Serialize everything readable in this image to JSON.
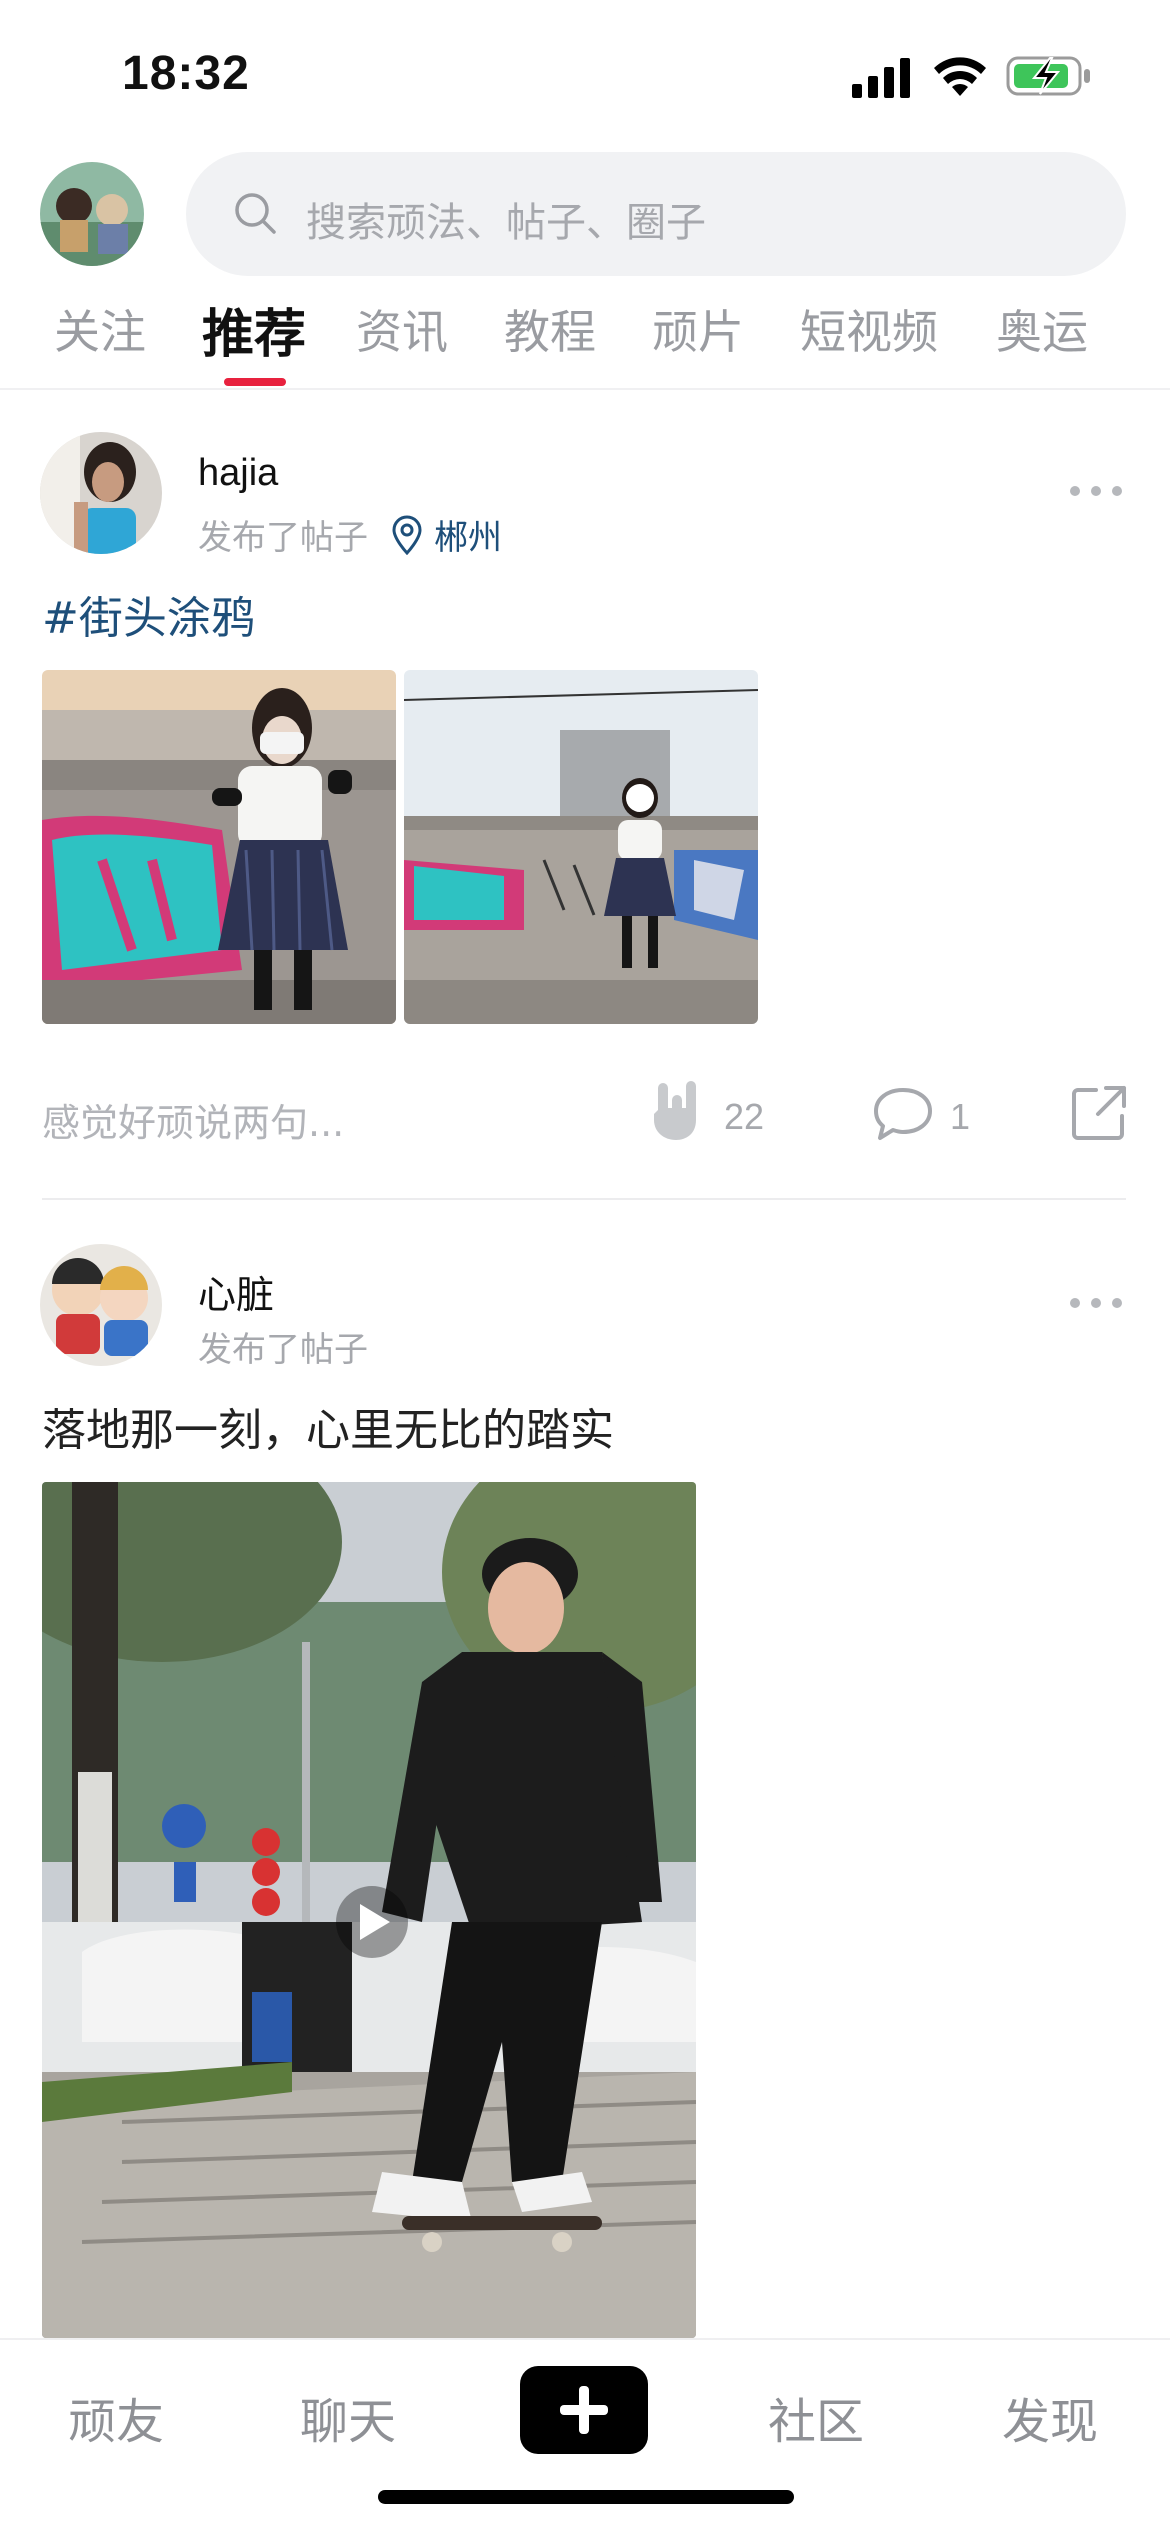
{
  "status_bar": {
    "time": "18:32"
  },
  "search": {
    "placeholder": "搜索顽法、帖子、圈子"
  },
  "tabs": [
    {
      "label": "关注",
      "active": false
    },
    {
      "label": "推荐",
      "active": true
    },
    {
      "label": "资讯",
      "active": false
    },
    {
      "label": "教程",
      "active": false
    },
    {
      "label": "顽片",
      "active": false
    },
    {
      "label": "短视频",
      "active": false
    },
    {
      "label": "奥运",
      "active": false
    }
  ],
  "posts": [
    {
      "username": "hajia",
      "action": "发布了帖子",
      "location": "郴州",
      "tag": "#街头涂鸦",
      "comment_prompt": "感觉好顽说两句...",
      "likes": "22",
      "comments": "1"
    },
    {
      "username": "心脏",
      "action": "发布了帖子",
      "text": "落地那一刻，心里无比的踏实"
    }
  ],
  "bottom_nav": {
    "items": [
      "顽友",
      "聊天",
      "社区",
      "发现"
    ]
  },
  "colors": {
    "accent": "#e8223f",
    "location_link": "#1e4f7a",
    "search_bg": "#f1f2f4"
  }
}
